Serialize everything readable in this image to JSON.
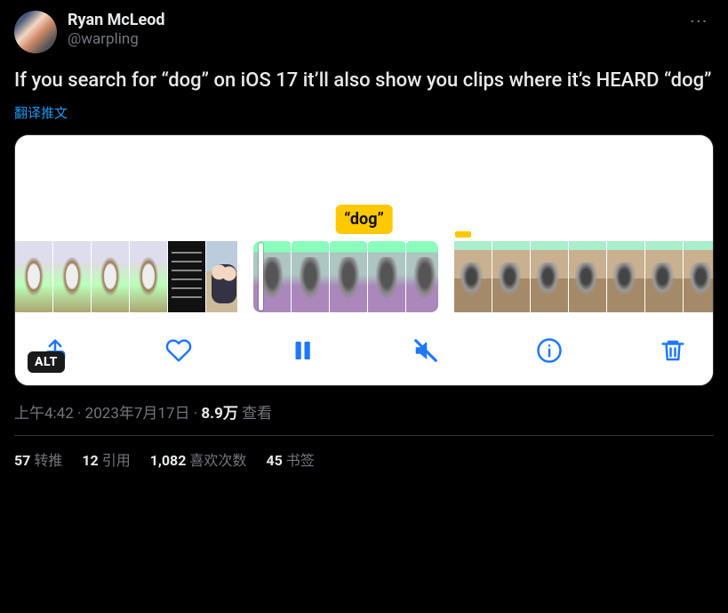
{
  "author": {
    "display_name": "Ryan McLeod",
    "handle": "@warpling"
  },
  "body_text": "If you search for “dog” on iOS 17 it’ll also show you clips where it’s HEARD “dog”",
  "translate_label": "翻译推文",
  "media": {
    "caption_bubble": "“dog”",
    "alt_badge": "ALT"
  },
  "meta": {
    "time": "上午4:42",
    "date": "2023年7月17日",
    "views_number": "8.9万",
    "views_label": "查看",
    "sep": " · "
  },
  "stats": {
    "retweets_num": "57",
    "retweets_label": "转推",
    "quotes_num": "12",
    "quotes_label": "引用",
    "likes_num": "1,082",
    "likes_label": "喜欢次数",
    "bookmarks_num": "45",
    "bookmarks_label": "书签"
  }
}
